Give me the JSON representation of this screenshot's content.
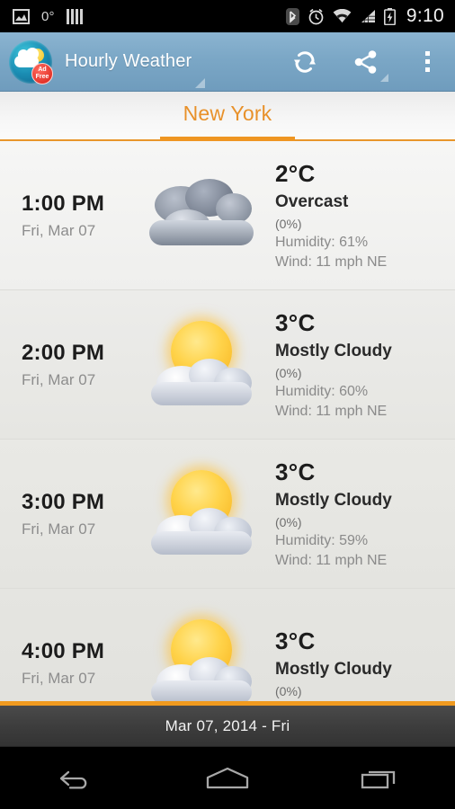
{
  "statusbar": {
    "left_icons": [
      "screenshot-icon",
      "barcode-icon"
    ],
    "temperature": "0°",
    "right_icons": [
      "bluetooth-icon",
      "alarm-icon",
      "wifi-icon",
      "signal-icon",
      "battery-charging-icon"
    ],
    "clock": "9:10"
  },
  "actionbar": {
    "app_icon": "weather-app-icon",
    "badge_line1": "Ad",
    "badge_line2": "Free",
    "title": "Hourly Weather",
    "refresh_label": "refresh-icon",
    "share_label": "share-icon",
    "overflow_label": "overflow-menu-icon"
  },
  "tabs": [
    {
      "label": "New York",
      "selected": true
    }
  ],
  "accent_color": "#ef9622",
  "hours": [
    {
      "time": "1:00 PM",
      "date": "Fri, Mar 07",
      "icon": "overcast-icon",
      "temp": "2°C",
      "condition": "Overcast",
      "precip": "(0%)",
      "humidity": "Humidity: 61%",
      "wind": "Wind: 11 mph NE"
    },
    {
      "time": "2:00 PM",
      "date": "Fri, Mar 07",
      "icon": "mostly-cloudy-icon",
      "temp": "3°C",
      "condition": "Mostly Cloudy",
      "precip": "(0%)",
      "humidity": "Humidity: 60%",
      "wind": "Wind: 11 mph NE"
    },
    {
      "time": "3:00 PM",
      "date": "Fri, Mar 07",
      "icon": "mostly-cloudy-icon",
      "temp": "3°C",
      "condition": "Mostly Cloudy",
      "precip": "(0%)",
      "humidity": "Humidity: 59%",
      "wind": "Wind: 11 mph NE"
    },
    {
      "time": "4:00 PM",
      "date": "Fri, Mar 07",
      "icon": "mostly-cloudy-icon",
      "temp": "3°C",
      "condition": "Mostly Cloudy",
      "precip": "(0%)",
      "humidity": "",
      "wind": ""
    }
  ],
  "footer": {
    "date_label": "Mar 07, 2014 - Fri"
  },
  "navbar": {
    "back": "back-icon",
    "home": "home-icon",
    "recents": "recents-icon"
  }
}
